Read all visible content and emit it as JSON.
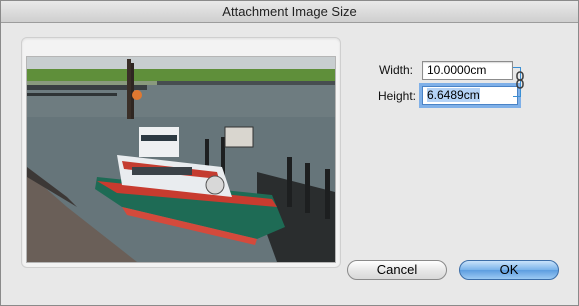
{
  "window": {
    "title": "Attachment Image Size"
  },
  "preview": {
    "alt": "attached image preview: lifeboat moored in a harbour"
  },
  "fields": {
    "width": {
      "label": "Width:",
      "value": "10.0000cm"
    },
    "height": {
      "label": "Height:",
      "value": "6.6489cm"
    }
  },
  "link_icon": "chain-link-icon",
  "buttons": {
    "cancel": "Cancel",
    "ok": "OK"
  },
  "colors": {
    "default_button": "#6aa7e6",
    "focus_ring": "#7fb0e8",
    "link_bracket": "#3a8fd4"
  }
}
